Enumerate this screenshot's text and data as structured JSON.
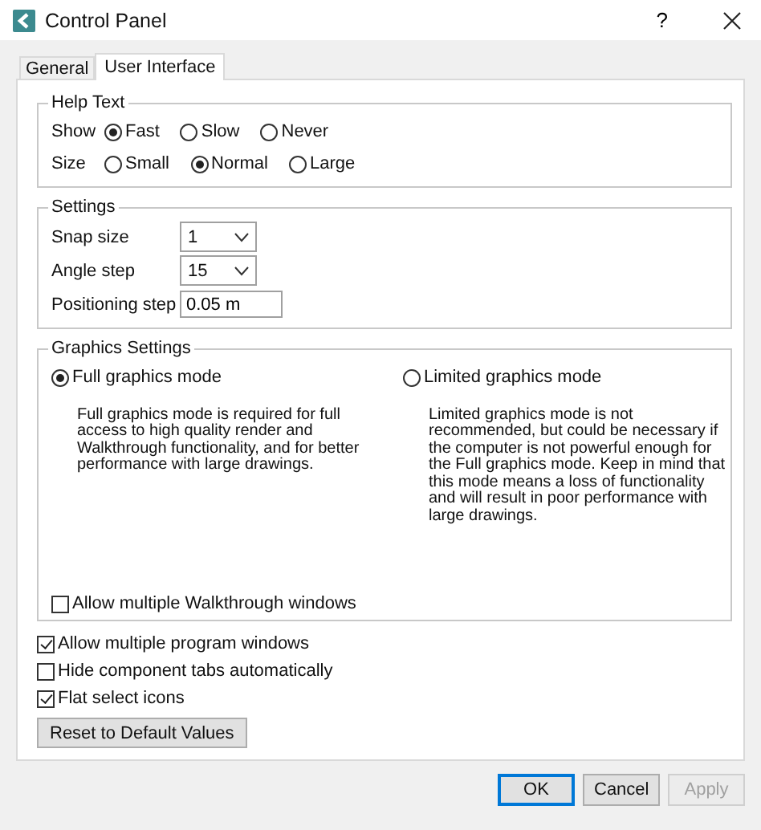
{
  "window": {
    "title": "Control Panel",
    "help": "?"
  },
  "tabs": [
    {
      "label": "General",
      "selected": false
    },
    {
      "label": "User Interface",
      "selected": true
    }
  ],
  "help_text": {
    "title": "Help Text",
    "rows": [
      {
        "label": "Show",
        "options": [
          {
            "label": "Fast",
            "selected": true
          },
          {
            "label": "Slow",
            "selected": false
          },
          {
            "label": "Never",
            "selected": false
          }
        ]
      },
      {
        "label": "Size",
        "options": [
          {
            "label": "Small",
            "selected": false
          },
          {
            "label": "Normal",
            "selected": true
          },
          {
            "label": "Large",
            "selected": false
          }
        ]
      }
    ]
  },
  "settings": {
    "title": "Settings",
    "fields": [
      {
        "label": "Snap size",
        "kind": "dropdown",
        "value": "1"
      },
      {
        "label": "Angle step",
        "kind": "dropdown",
        "value": "15"
      },
      {
        "label": "Positioning step",
        "kind": "text",
        "value": "0.05 m"
      }
    ]
  },
  "graphics": {
    "title": "Graphics Settings",
    "modes": [
      {
        "label": "Full graphics mode",
        "selected": true,
        "description": "Full graphics mode is required for full access to high quality render and Walkthrough functionality, and for better performance with large drawings."
      },
      {
        "label": "Limited graphics mode",
        "selected": false,
        "description": "Limited graphics mode is not recommended, but could be necessary if the computer is not powerful enough for the Full graphics mode. Keep in mind that this mode means a loss of functionality and will result in poor performance with large drawings."
      }
    ],
    "walkthrough": {
      "label": "Allow multiple Walkthrough windows",
      "checked": false
    }
  },
  "options": [
    {
      "label": "Allow multiple program windows",
      "checked": true
    },
    {
      "label": "Hide component tabs automatically",
      "checked": false
    },
    {
      "label": "Flat select icons",
      "checked": true
    }
  ],
  "reset_button": "Reset to Default Values",
  "buttons": [
    {
      "label": "OK",
      "default": true,
      "disabled": false
    },
    {
      "label": "Cancel",
      "default": false,
      "disabled": false
    },
    {
      "label": "Apply",
      "default": false,
      "disabled": true
    }
  ]
}
